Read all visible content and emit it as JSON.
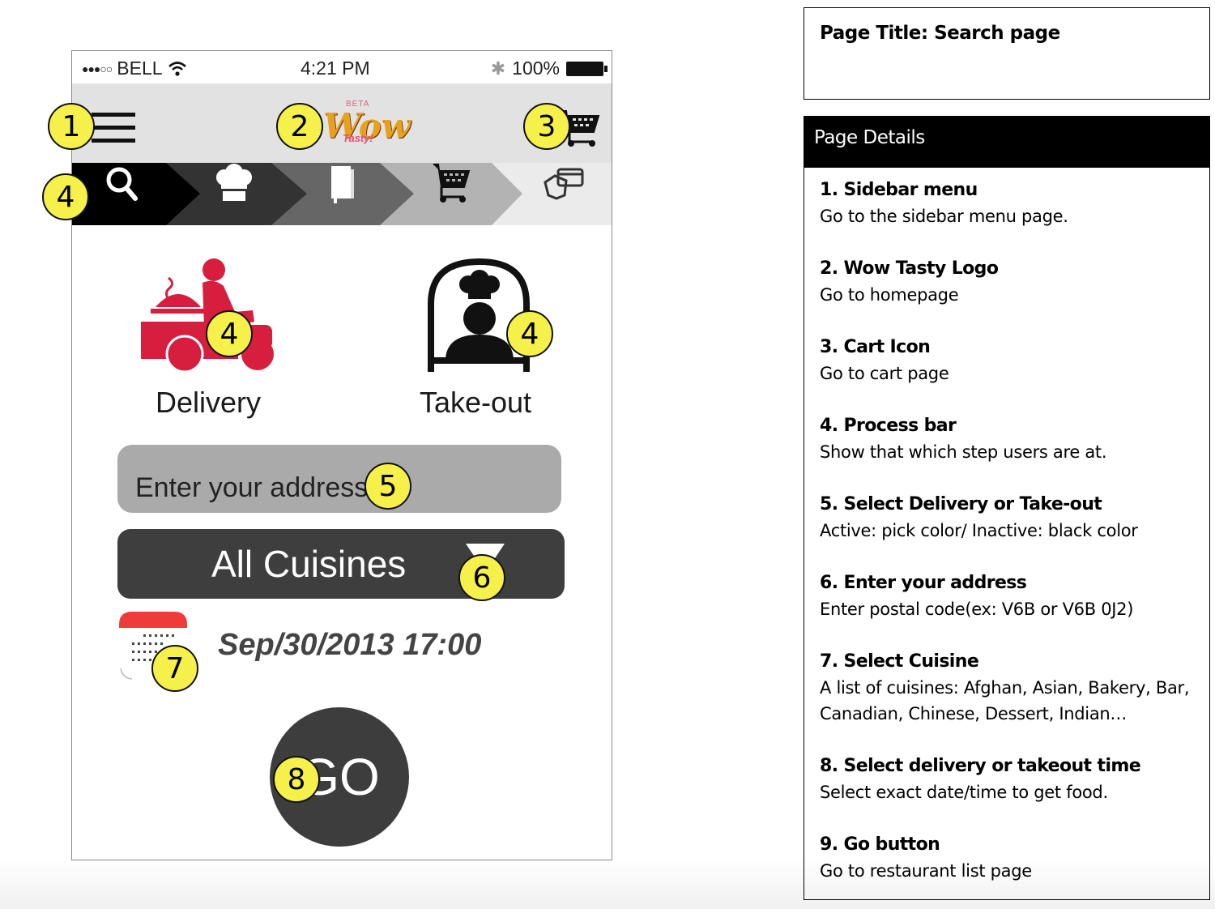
{
  "phone": {
    "status_bar": {
      "signal": "●●●○○",
      "carrier": "BELL",
      "time": "4:21 PM",
      "battery": "100%"
    },
    "navbar": {
      "menu_icon": "hamburger-icon",
      "logo_beta": "BETA",
      "logo_main": "Wow",
      "logo_sub": "Tasty!",
      "cart_icon": "cart-icon"
    },
    "process_bar": {
      "steps": [
        {
          "icon": "search-icon",
          "color": "#000000",
          "active": true
        },
        {
          "icon": "chef-hat-icon",
          "color": "#333333",
          "active": false
        },
        {
          "icon": "menu-book-icon",
          "color": "#666666",
          "active": false
        },
        {
          "icon": "cart-icon",
          "color": "#b3b3b3",
          "active": false
        },
        {
          "icon": "payment-card-icon",
          "color": "#ebebeb",
          "active": false
        }
      ]
    },
    "modes": {
      "delivery": {
        "label": "Delivery",
        "color": "#d81e3f"
      },
      "takeout": {
        "label": "Take-out",
        "color": "#111111"
      }
    },
    "address": {
      "placeholder": "Enter your address",
      "value": ""
    },
    "cuisine": {
      "selected": "All Cuisines"
    },
    "datetime": {
      "value": "Sep/30/2013 17:00"
    },
    "go_button": {
      "label": "GO"
    }
  },
  "callouts": [
    "1",
    "2",
    "3",
    "4",
    "4",
    "4",
    "5",
    "6",
    "7",
    "8"
  ],
  "spec": {
    "title": "Page Title: Search page",
    "details_header": "Page Details",
    "items": [
      {
        "heading": "1. Sidebar menu",
        "desc": "Go to the sidebar menu page."
      },
      {
        "heading": "2. Wow Tasty Logo",
        "desc": "Go to homepage"
      },
      {
        "heading": "3. Cart Icon",
        "desc": "Go to cart page"
      },
      {
        "heading": "4. Process bar",
        "desc": "Show that which step users are at."
      },
      {
        "heading": "5. Select Delivery or Take-out",
        "desc": "Active: pick color/ Inactive: black color"
      },
      {
        "heading": "6. Enter your address",
        "desc": "Enter postal code(ex: V6B or V6B 0J2)"
      },
      {
        "heading": "7. Select Cuisine",
        "desc": "A list of cuisines: Afghan, Asian, Bakery, Bar, Canadian, Chinese, Dessert, Indian…"
      },
      {
        "heading": "8. Select delivery or takeout time",
        "desc": "Select exact date/time to get food."
      },
      {
        "heading": "9. Go button",
        "desc": "Go to restaurant list page"
      }
    ]
  }
}
